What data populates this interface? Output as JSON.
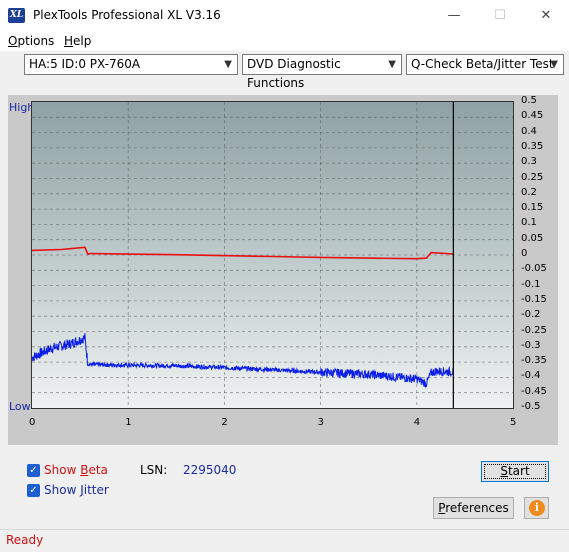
{
  "window": {
    "title": "PlexTools Professional XL V3.16",
    "icon_text": "XL"
  },
  "controls": {
    "minimize": "—",
    "maximize": "☐",
    "close": "✕"
  },
  "menu": [
    {
      "first": "O",
      "rest": "ptions"
    },
    {
      "first": "H",
      "rest": "elp"
    }
  ],
  "toolbar": {
    "drive": "HA:5 ID:0  PX-760A",
    "function": "DVD Diagnostic Functions",
    "test": "Q-Check Beta/Jitter Test"
  },
  "chart_data": {
    "type": "line",
    "left_axis_labels": {
      "top": "High",
      "bottom": "Low"
    },
    "x_ticks": [
      "0",
      "1",
      "2",
      "3",
      "4",
      "5"
    ],
    "xlim": [
      0,
      5
    ],
    "y_ticks": [
      "0.5",
      "0.45",
      "0.4",
      "0.35",
      "0.3",
      "0.25",
      "0.2",
      "0.15",
      "0.1",
      "0.05",
      "0",
      "-0.05",
      "-0.1",
      "-0.15",
      "-0.2",
      "-0.25",
      "-0.3",
      "-0.35",
      "-0.4",
      "-0.45",
      "-0.5"
    ],
    "ylim": [
      -0.5,
      0.5
    ],
    "grid": true,
    "marker_x": 4.38,
    "series": [
      {
        "key": "beta",
        "color": "#e81010",
        "x": [
          0,
          0.3,
          0.55,
          0.58,
          0.6,
          1.5,
          2.5,
          3.0,
          3.5,
          4.0,
          4.1,
          4.15,
          4.3,
          4.38
        ],
        "y": [
          0.015,
          0.018,
          0.025,
          0.003,
          0.005,
          0.001,
          -0.005,
          -0.008,
          -0.01,
          -0.012,
          -0.01,
          0.008,
          0.005,
          0.003
        ]
      },
      {
        "key": "jitter",
        "color": "#0b1ee8",
        "x": [
          0,
          0.2,
          0.4,
          0.55,
          0.58,
          0.6,
          1.0,
          1.5,
          2.0,
          2.5,
          3.0,
          3.5,
          4.0,
          4.1,
          4.15,
          4.2,
          4.38
        ],
        "y": [
          -0.335,
          -0.305,
          -0.29,
          -0.27,
          -0.355,
          -0.358,
          -0.36,
          -0.362,
          -0.368,
          -0.375,
          -0.383,
          -0.39,
          -0.405,
          -0.42,
          -0.385,
          -0.38,
          -0.382
        ],
        "noise": 0.012
      }
    ]
  },
  "options": {
    "show_beta": {
      "label_pre": "Show ",
      "label_u": "B",
      "label_post": "eta",
      "checked": true,
      "color": "#d01010"
    },
    "show_jitter": {
      "label_pre": "Show ",
      "label_u": "J",
      "label_post": "itter",
      "checked": true,
      "color": "#1a2aa0"
    }
  },
  "lsn": {
    "label": "LSN:",
    "value": "2295040"
  },
  "buttons": {
    "start": {
      "u": "S",
      "rest": "tart"
    },
    "preferences": {
      "pre": "",
      "u": "P",
      "rest": "references"
    },
    "info": "i"
  },
  "status": "Ready"
}
